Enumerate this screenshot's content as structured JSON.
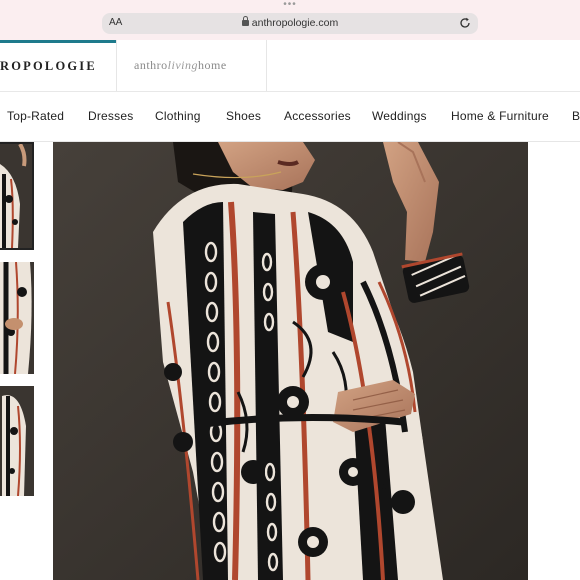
{
  "browser": {
    "text_size_label": "AA",
    "url": "anthropologie.com"
  },
  "header": {
    "brand": "ROPOLOGIE",
    "living_home": {
      "prefix": "anthro",
      "script": "living",
      "suffix": "home"
    }
  },
  "nav": {
    "items": [
      {
        "label": "Top-Rated"
      },
      {
        "label": "Dresses"
      },
      {
        "label": "Clothing"
      },
      {
        "label": "Shoes"
      },
      {
        "label": "Accessories"
      },
      {
        "label": "Weddings"
      },
      {
        "label": "Home & Furniture"
      },
      {
        "label": "B"
      }
    ]
  },
  "gallery": {
    "thumbnails": 3,
    "selected_index": 0
  },
  "colors": {
    "accent": "#1e7a8c",
    "print_rust": "#b0472e",
    "print_black": "#141414",
    "print_cream": "#ece4da",
    "backdrop": "#3b3630"
  }
}
